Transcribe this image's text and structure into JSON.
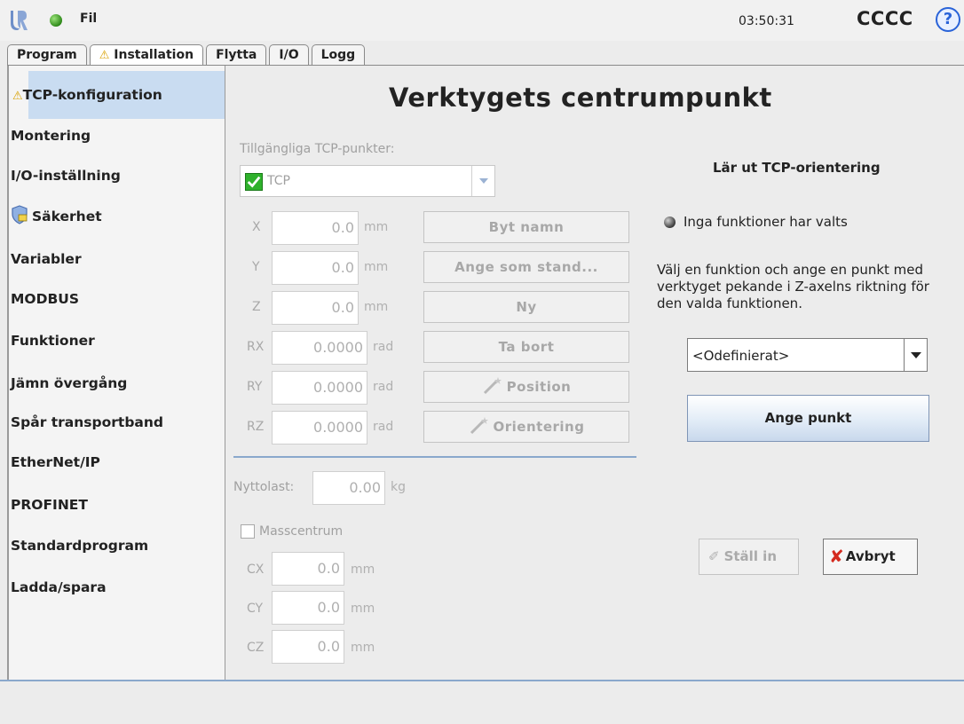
{
  "topbar": {
    "file_label": "Fil",
    "clock": "03:50:31",
    "robot_name": "CCCC",
    "help_symbol": "?",
    "status_color": "#3c9b25"
  },
  "tabs": [
    {
      "label": "Program",
      "active": false
    },
    {
      "label": "Installation",
      "active": true,
      "warning": true
    },
    {
      "label": "Flytta",
      "active": false
    },
    {
      "label": "I/O",
      "active": false
    },
    {
      "label": "Logg",
      "active": false
    }
  ],
  "warning_symbol": "⚠",
  "sidebar": {
    "items": [
      {
        "label": "TCP-konfiguration",
        "active": true,
        "icon": "warning-icon"
      },
      {
        "label": "Montering"
      },
      {
        "label": "I/O-inställning"
      },
      {
        "label": "Säkerhet",
        "icon": "safety-shield-icon"
      },
      {
        "label": "Variabler"
      },
      {
        "label": "MODBUS"
      },
      {
        "label": "Funktioner"
      },
      {
        "label": "Jämn övergång"
      },
      {
        "label": "Spår transportband"
      },
      {
        "label": "EtherNet/IP"
      },
      {
        "label": "PROFINET"
      },
      {
        "label": "Standardprogram"
      },
      {
        "label": "Ladda/spara"
      }
    ]
  },
  "main": {
    "title": "Verktygets centrumpunkt",
    "available_tcp_label": "Tillgängliga TCP-punkter:",
    "tcp_selected": "TCP",
    "fields": [
      {
        "axis": "X",
        "value": "0.0",
        "unit": "mm"
      },
      {
        "axis": "Y",
        "value": "0.0",
        "unit": "mm"
      },
      {
        "axis": "Z",
        "value": "0.0",
        "unit": "mm"
      },
      {
        "axis": "RX",
        "value": "0.0000",
        "unit": "rad"
      },
      {
        "axis": "RY",
        "value": "0.0000",
        "unit": "rad"
      },
      {
        "axis": "RZ",
        "value": "0.0000",
        "unit": "rad"
      }
    ],
    "buttons": {
      "rename": "Byt namn",
      "set_default": "Ange som stand...",
      "new": "Ny",
      "remove": "Ta bort",
      "position": "Position",
      "orientation": "Orientering"
    },
    "payload": {
      "label": "Nyttolast:",
      "value": "0.00",
      "unit": "kg"
    },
    "mass_center": {
      "label": "Masscentrum",
      "checked": false,
      "fields": [
        {
          "axis": "CX",
          "value": "0.0",
          "unit": "mm"
        },
        {
          "axis": "CY",
          "value": "0.0",
          "unit": "mm"
        },
        {
          "axis": "CZ",
          "value": "0.0",
          "unit": "mm"
        }
      ]
    }
  },
  "teach": {
    "title": "Lär ut TCP-orientering",
    "status": "Inga funktioner har valts",
    "instruction": "Välj en funktion och ange en punkt med verktyget pekande i Z-axelns riktning för den valda funktionen.",
    "feature_select": "<Odefinierat>",
    "set_point_button": "Ange punkt",
    "apply_button": "Ställ in",
    "cancel_button": "Avbryt"
  }
}
